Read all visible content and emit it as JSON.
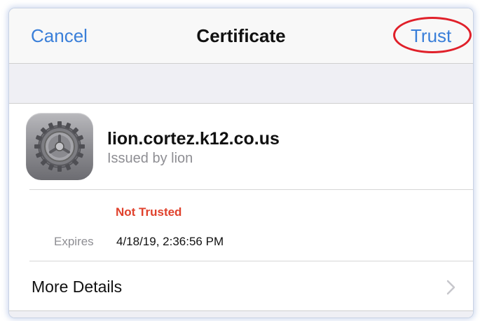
{
  "navbar": {
    "cancel_label": "Cancel",
    "title": "Certificate",
    "trust_label": "Trust"
  },
  "certificate": {
    "icon": "gear-icon",
    "name": "lion.cortez.k12.co.us",
    "issuer": "Issued by lion",
    "status": "Not Trusted",
    "expires_label": "Expires",
    "expires_value": "4/18/19, 2:36:56 PM"
  },
  "details": {
    "label": "More Details",
    "icon": "chevron-right-icon"
  },
  "colors": {
    "accent": "#3a7fd9",
    "danger": "#e0412c",
    "annotation": "#e0202a",
    "secondary_text": "#8e8e93",
    "grouped_bg": "#efeff4"
  }
}
